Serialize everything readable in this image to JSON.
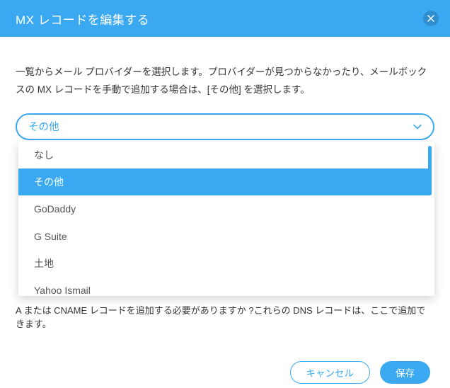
{
  "header": {
    "title": "MX レコードを編集する"
  },
  "body": {
    "description": "一覧からメール プロバイダーを選択します。プロバイダーが見つからなかったり、メールボックスの MX レコードを手動で追加する場合は、[その他] を選択します。",
    "footer_text": "A または CNAME レコードを追加する必要がありますか ?これらの DNS レコードは、ここで追加できます。"
  },
  "select": {
    "selected": "その他",
    "options": [
      {
        "label": "なし",
        "selected": false
      },
      {
        "label": "その他",
        "selected": true
      },
      {
        "label": "GoDaddy",
        "selected": false
      },
      {
        "label": "G Suite",
        "selected": false
      },
      {
        "label": "土地",
        "selected": false
      },
      {
        "label": "Yahoo Ismail",
        "selected": false
      }
    ]
  },
  "buttons": {
    "cancel": "キャンセル",
    "save": "保存"
  },
  "colors": {
    "accent": "#3aa9f2"
  }
}
